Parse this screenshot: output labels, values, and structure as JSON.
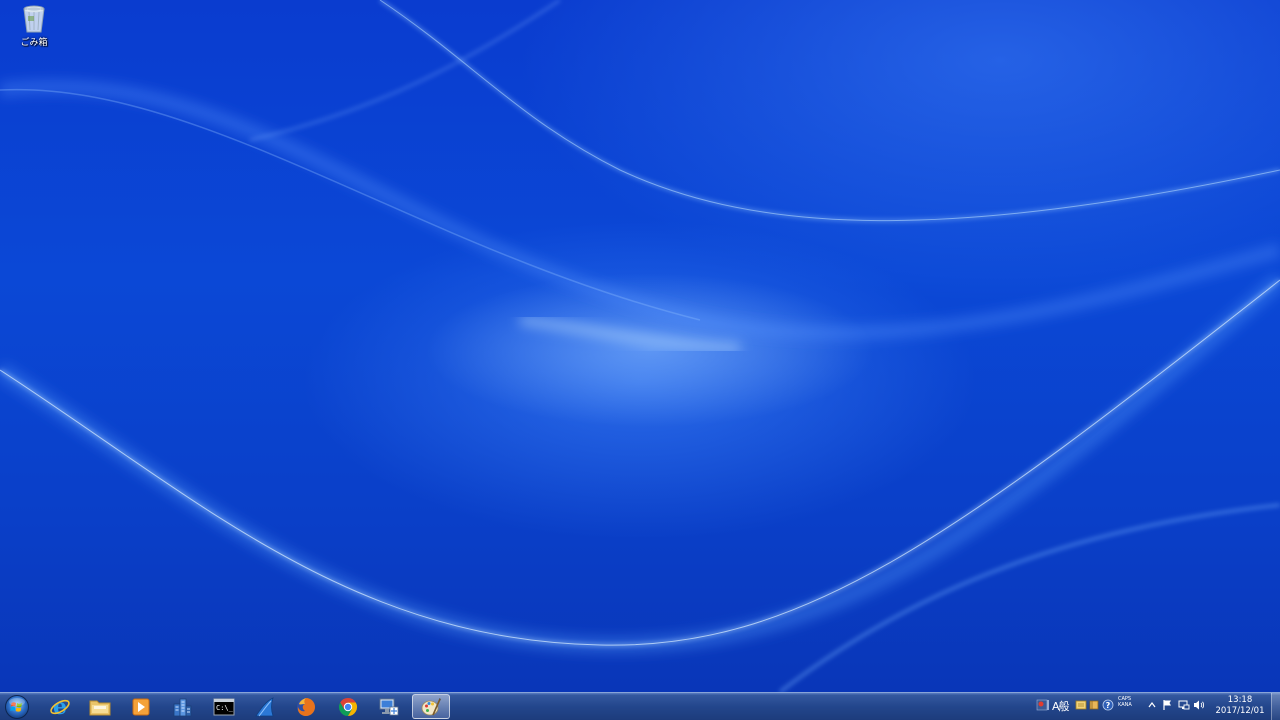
{
  "desktop": {
    "icons": [
      {
        "label": "ごみ箱",
        "icon": "recycle-bin-icon"
      }
    ]
  },
  "taskbar": {
    "start_button": {
      "icon": "windows-start-orb-icon"
    },
    "pinned_apps": [
      {
        "name": "internet-explorer",
        "icon": "internet-explorer-icon"
      },
      {
        "name": "file-explorer",
        "icon": "folder-icon"
      },
      {
        "name": "media-player",
        "icon": "media-player-icon"
      },
      {
        "name": "app-buildings",
        "icon": "buildings-icon"
      },
      {
        "name": "command-prompt",
        "icon": "command-prompt-icon"
      },
      {
        "name": "app-shark-fin",
        "icon": "shark-fin-icon"
      },
      {
        "name": "firefox",
        "icon": "firefox-icon"
      },
      {
        "name": "chrome",
        "icon": "chrome-icon"
      },
      {
        "name": "remote-desktop",
        "icon": "remote-desktop-icon"
      },
      {
        "name": "paint",
        "icon": "paint-icon",
        "active": true
      }
    ],
    "tray": {
      "ime_mode": "A般",
      "caps_line1": "CAPS",
      "caps_line2": "KANA",
      "time": "13:18",
      "date": "2017/12/01"
    }
  },
  "colors": {
    "wallpaper": "#0a3fc4",
    "taskbar": "#23468c"
  }
}
